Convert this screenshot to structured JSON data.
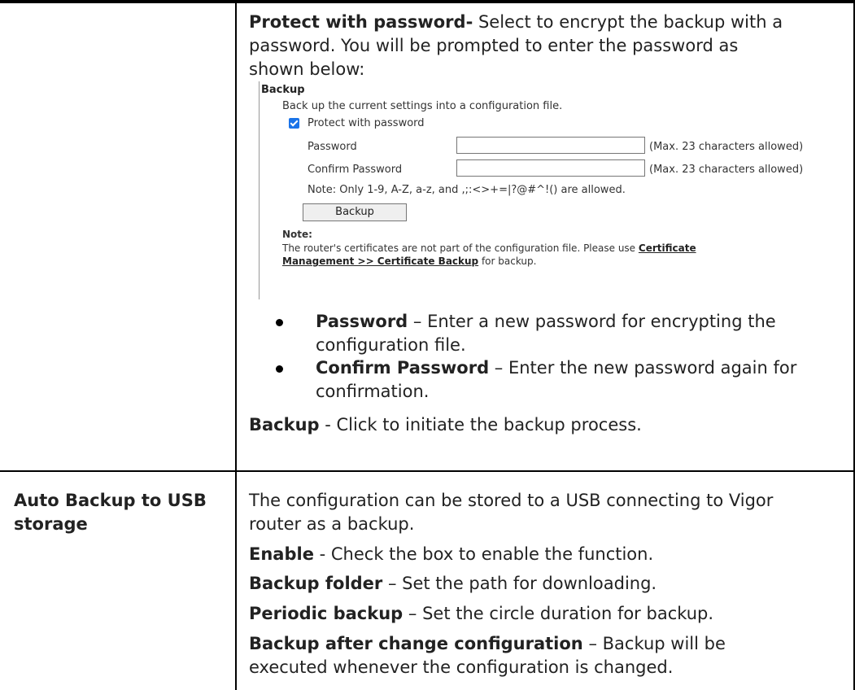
{
  "top_cell": {
    "protect_title": "Protect with password-",
    "protect_desc_1": " Select to encrypt the backup with a",
    "protect_desc_2": "password. You will be prompted to enter the password as",
    "protect_desc_3": "shown below:"
  },
  "screenshot": {
    "header": "Backup",
    "intro": "Back up the current settings into a configuration file.",
    "protect_label": "Protect with password",
    "password_label": "Password",
    "password_hint": "(Max. 23 characters allowed)",
    "confirm_label": "Confirm Password",
    "confirm_hint": "(Max. 23 characters allowed)",
    "allowed_note": "Note: Only 1-9, A-Z, a-z, and ,;:<>+=|?@#^!() are allowed.",
    "backup_button": "Backup",
    "note_title": "Note:",
    "note_text_1": "The router's certificates are not part of the configuration file. Please use ",
    "note_link_1": "Certificate",
    "note_link_2": "Management >> Certificate Backup",
    "note_text_2": " for backup."
  },
  "bullets": [
    {
      "term": "Password",
      "desc_1": " – Enter a new password for encrypting the",
      "desc_2": "configuration file."
    },
    {
      "term": "Confirm Password",
      "desc_1": " – Enter the new password again for",
      "desc_2": "confirmation."
    }
  ],
  "backup_line": {
    "term": "Backup",
    "desc": " - Click to initiate the backup process."
  },
  "auto_backup": {
    "label_1": "Auto Backup to USB",
    "label_2": "storage",
    "intro_1": "The configuration can be stored to a USB connecting to Vigor",
    "intro_2": "router as a backup.",
    "enable_term": "Enable",
    "enable_desc": " - Check the box to enable the function.",
    "folder_term": "Backup folder",
    "folder_desc": " – Set the path for downloading.",
    "periodic_term": "Periodic backup",
    "periodic_desc": " – Set the circle duration for backup.",
    "after_term": "Backup after change configuration",
    "after_desc_1": " – Backup will be",
    "after_desc_2": "executed whenever the configuration is changed."
  }
}
